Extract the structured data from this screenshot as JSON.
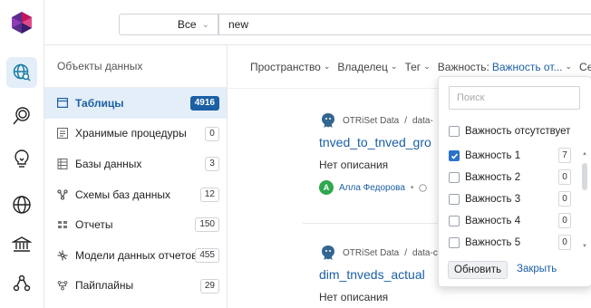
{
  "search": {
    "scope_value": "Все",
    "query_value": "new"
  },
  "categories": {
    "header": "Объекты данных",
    "items": [
      {
        "label": "Таблицы",
        "count": "4916",
        "icon": "table-icon"
      },
      {
        "label": "Хранимые процедуры",
        "count": "0",
        "icon": "stored-procedure-icon"
      },
      {
        "label": "Базы данных",
        "count": "3",
        "icon": "database-icon"
      },
      {
        "label": "Схемы баз данных",
        "count": "12",
        "icon": "schema-icon"
      },
      {
        "label": "Отчеты",
        "count": "150",
        "icon": "report-icon"
      },
      {
        "label": "Модели данных отчетов",
        "count": "455",
        "icon": "report-model-icon"
      },
      {
        "label": "Пайплайны",
        "count": "29",
        "icon": "pipeline-icon"
      }
    ]
  },
  "filters": {
    "space": "Пространство",
    "owner": "Владелец",
    "tag": "Тег",
    "importance_label": "Важность:",
    "importance_value": "Важность от...",
    "next_partial": "Се"
  },
  "results": [
    {
      "source": "OTRiSet Data",
      "path_partial": "data-",
      "title": "tnved_to_tnved_gro",
      "description": "Нет описания",
      "owner_initial": "А",
      "owner_name": "Алла Федорова"
    },
    {
      "source": "OTRiSet Data",
      "path_partial": "data-c",
      "title": "dim_tnveds_actual",
      "description": "Нет описания"
    }
  ],
  "dropdown": {
    "search_placeholder": "Поиск",
    "options": [
      {
        "label": "Важность отсутствует",
        "checked": false,
        "count": ""
      },
      {
        "label": "Важность 1",
        "checked": true,
        "count": "7"
      },
      {
        "label": "Важность 2",
        "checked": false,
        "count": "0"
      },
      {
        "label": "Важность 3",
        "checked": false,
        "count": "0"
      },
      {
        "label": "Важность 4",
        "checked": false,
        "count": "0"
      },
      {
        "label": "Важность 5",
        "checked": false,
        "count": "0"
      }
    ],
    "update_label": "Обновить",
    "close_label": "Закрыть"
  },
  "colors": {
    "accent": "#1b5fa5",
    "checkbox": "#2b73c9",
    "active_bg": "#e4eef8",
    "avatar": "#2fa84f"
  }
}
